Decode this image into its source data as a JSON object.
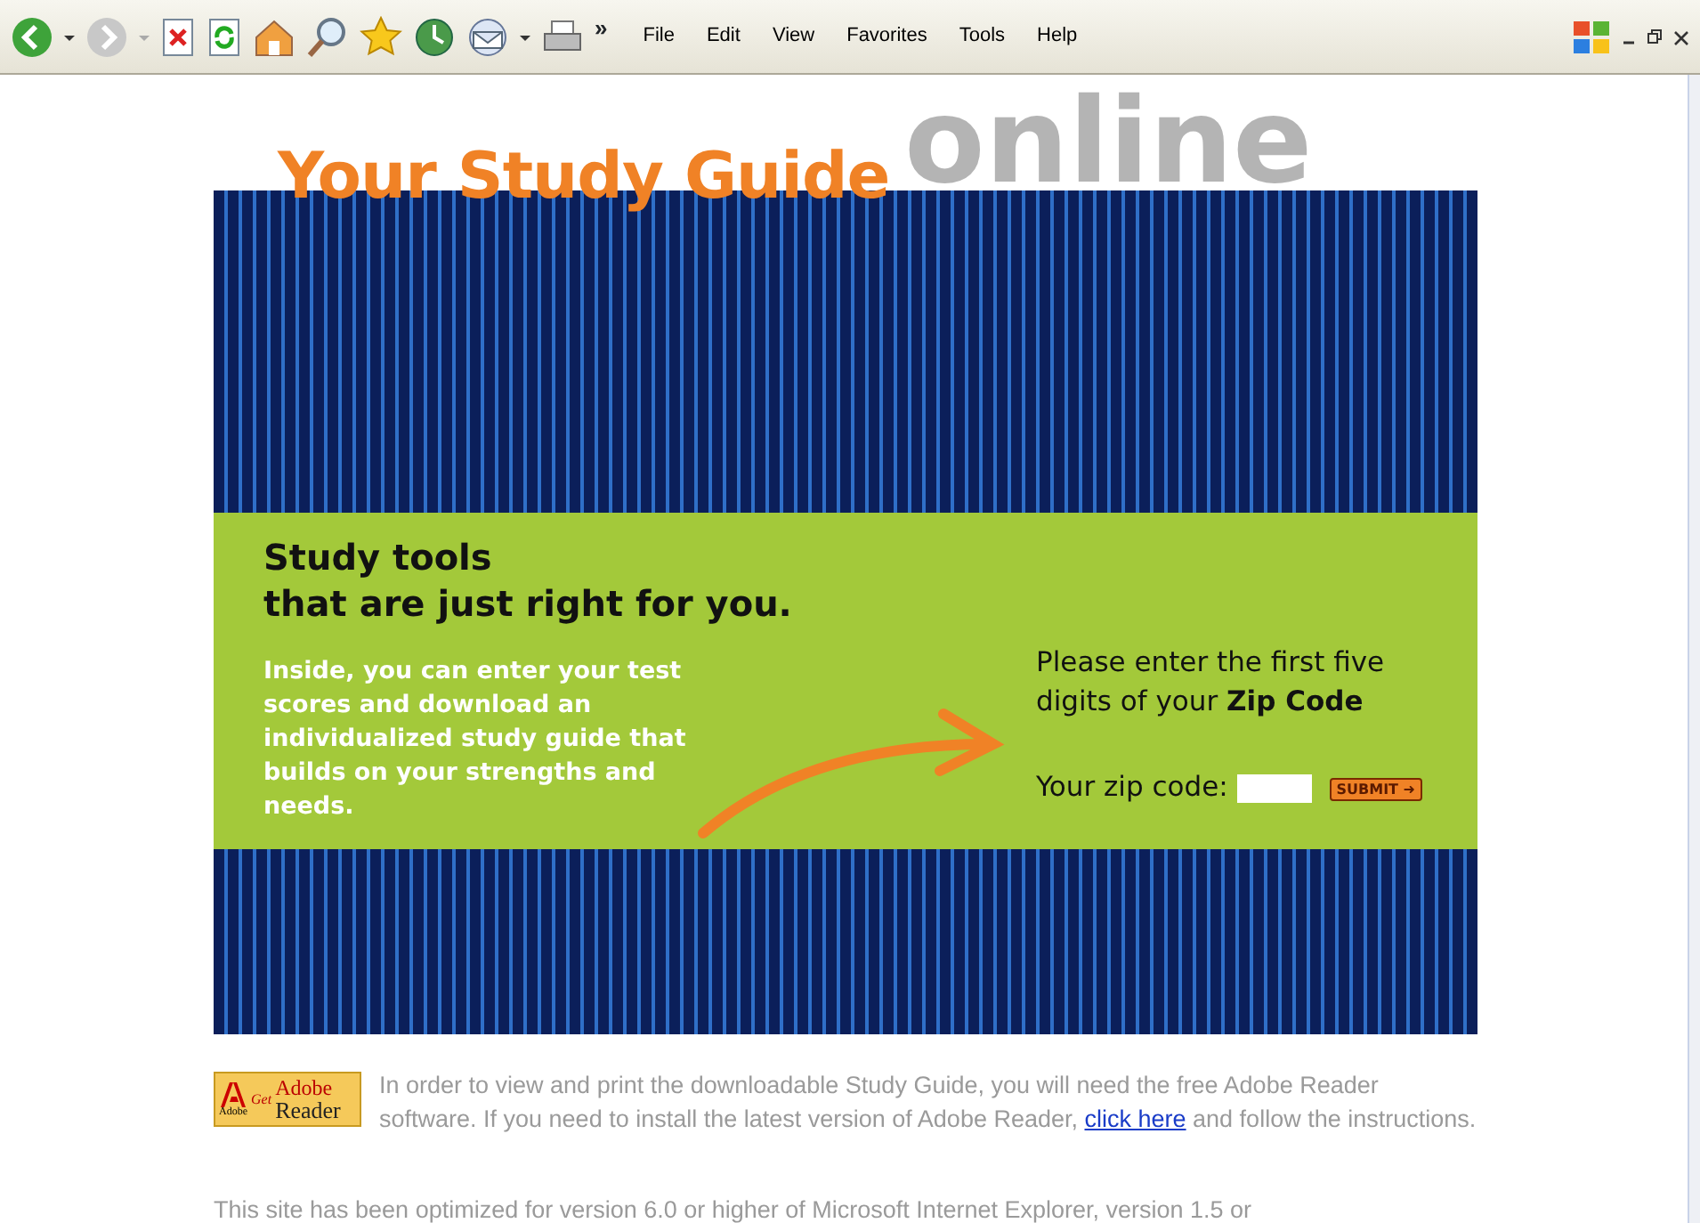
{
  "toolbar": {
    "chevron": "»",
    "menus": [
      "File",
      "Edit",
      "View",
      "Favorites",
      "Tools",
      "Help"
    ]
  },
  "header": {
    "title": "Your Study Guide",
    "watermark": "online"
  },
  "promo": {
    "heading_lines": [
      "Study tools",
      "that are just right for you."
    ],
    "body": "Inside, you can enter your test scores and download an individualized study guide that builds on your strengths and needs.",
    "prompt": "Please enter the first five digits of your **Zip Code**",
    "zip_label": "Your zip code:",
    "submit": "SUBMIT ➜"
  },
  "reader_badge": {
    "get": "Get",
    "brand": "Adobe",
    "product": "Reader",
    "maker": "Adobe"
  },
  "notice": {
    "before": "In order to view and print the downloadable Study Guide, you will need the free Adobe Reader software. If you need to install the latest version of Adobe Reader,",
    "link": "click here",
    "after": "and follow the instructions."
  },
  "footer_text": "This site has been optimized for version 6.0 or higher of Microsoft Internet Explorer, version 1.5 or"
}
